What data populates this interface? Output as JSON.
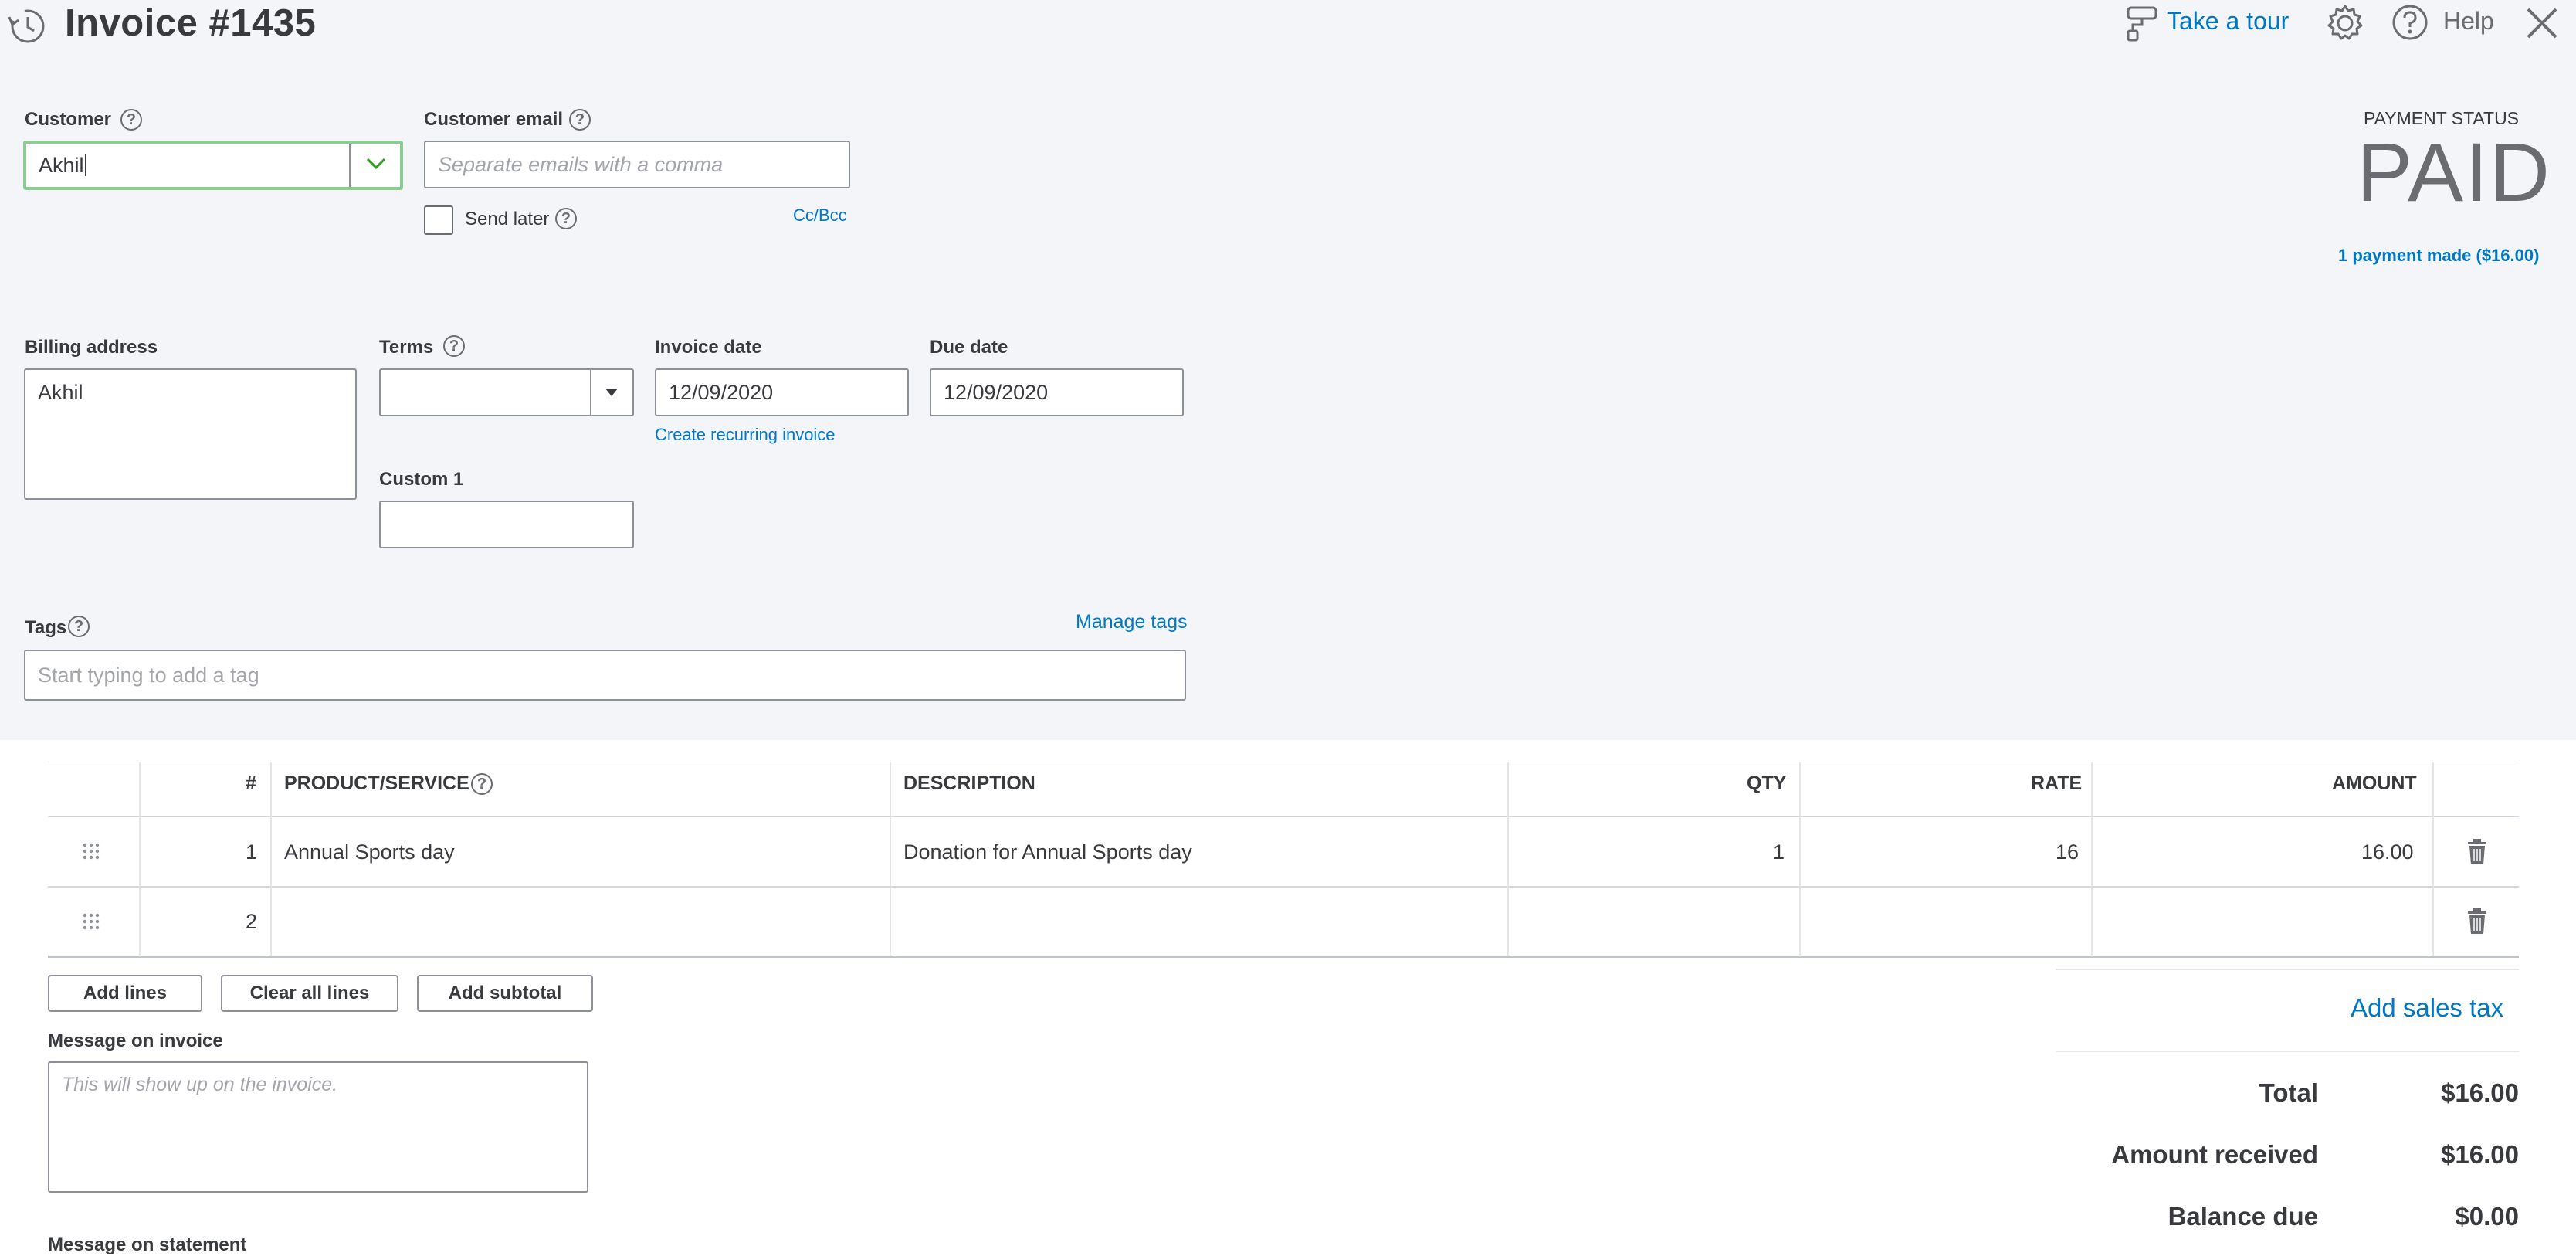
{
  "header": {
    "title": "Invoice #1435",
    "tour_label": "Take a tour",
    "help_label": "Help"
  },
  "customer": {
    "label": "Customer",
    "value": "Akhil",
    "email_label": "Customer email",
    "email_placeholder": "Separate emails with a comma",
    "send_later_label": "Send later",
    "cc_bcc_label": "Cc/Bcc"
  },
  "payment": {
    "status_label": "PAYMENT STATUS",
    "status_value": "PAID",
    "payments_link": "1 payment made ($16.00)"
  },
  "billing": {
    "label": "Billing address",
    "value": "Akhil"
  },
  "terms": {
    "label": "Terms",
    "value": ""
  },
  "invoice_date": {
    "label": "Invoice date",
    "value": "12/09/2020",
    "recurring_link": "Create recurring invoice"
  },
  "due_date": {
    "label": "Due date",
    "value": "12/09/2020"
  },
  "custom1": {
    "label": "Custom 1",
    "value": ""
  },
  "tags": {
    "label": "Tags",
    "manage_link": "Manage tags",
    "placeholder": "Start typing to add a tag"
  },
  "table": {
    "headers": {
      "num": "#",
      "product": "PRODUCT/SERVICE",
      "description": "DESCRIPTION",
      "qty": "QTY",
      "rate": "RATE",
      "amount": "AMOUNT"
    },
    "rows": [
      {
        "num": "1",
        "product": "Annual Sports day",
        "description": "Donation for Annual Sports day",
        "qty": "1",
        "rate": "16",
        "amount": "16.00"
      },
      {
        "num": "2",
        "product": "",
        "description": "",
        "qty": "",
        "rate": "",
        "amount": ""
      }
    ]
  },
  "buttons": {
    "add_lines": "Add lines",
    "clear_all_lines": "Clear all lines",
    "add_subtotal": "Add subtotal"
  },
  "message_invoice": {
    "label": "Message on invoice",
    "placeholder": "This will show up on the invoice."
  },
  "message_statement": {
    "label": "Message on statement"
  },
  "totals": {
    "add_sales_tax": "Add sales tax",
    "total_label": "Total",
    "total_value": "$16.00",
    "received_label": "Amount received",
    "received_value": "$16.00",
    "balance_label": "Balance due",
    "balance_value": "$0.00"
  },
  "colors": {
    "accent": "#0077c5",
    "focus_border": "#8dcb94",
    "background_top": "#f4f5f8"
  }
}
